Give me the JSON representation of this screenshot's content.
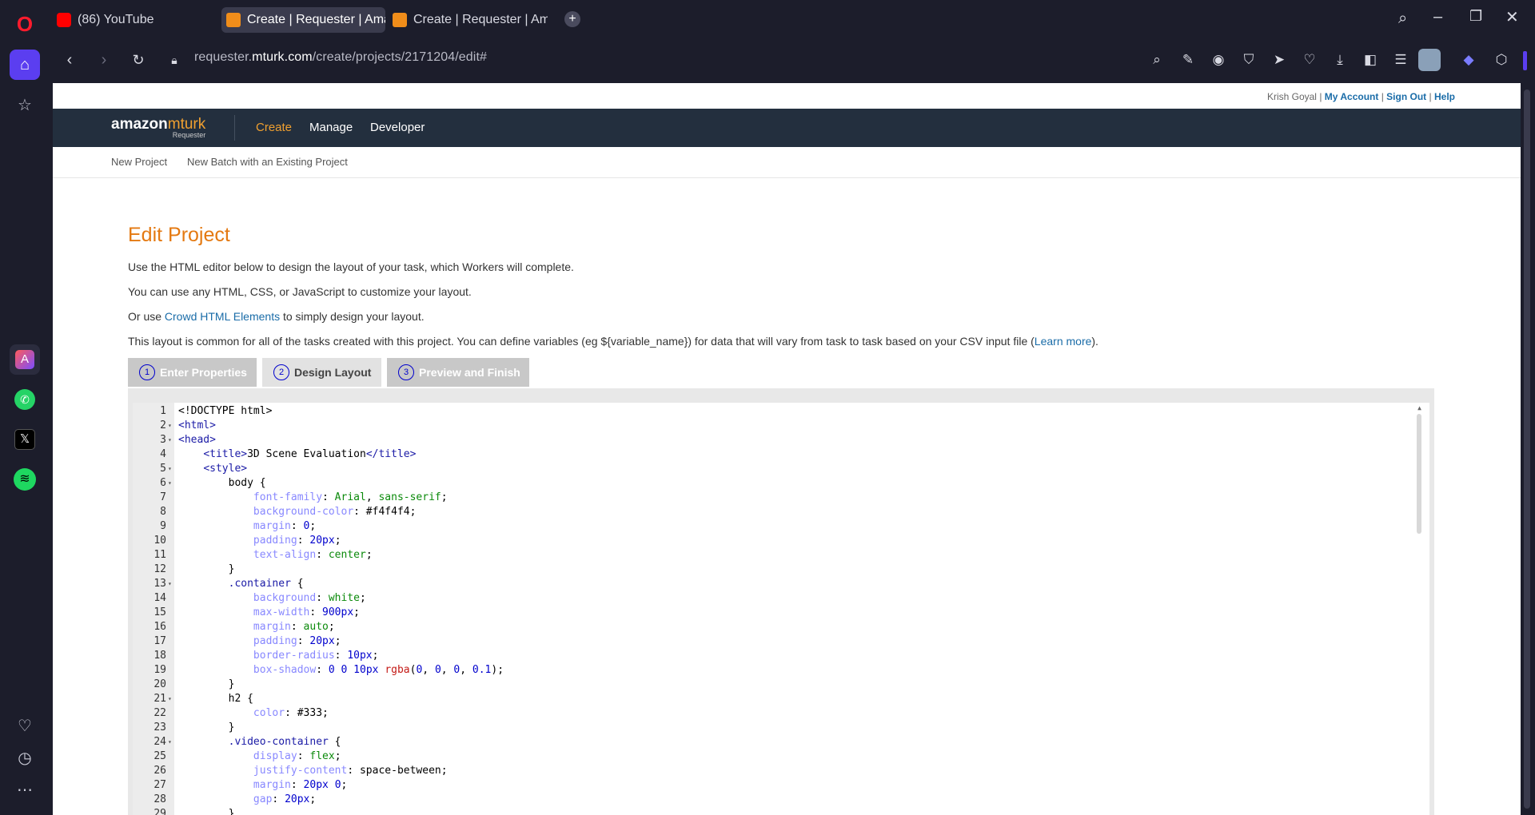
{
  "browser": {
    "tabs": [
      {
        "title": "(86) YouTube",
        "active": false,
        "favicon": "youtube-icon"
      },
      {
        "title": "Create | Requester | Amazon",
        "active": true,
        "favicon": "mturk-icon"
      },
      {
        "title": "Create | Requester | Amazon",
        "active": false,
        "favicon": "mturk-icon"
      }
    ],
    "url_prefix": "requester.",
    "url_domain": "mturk.com",
    "url_path": "/create/projects/2171204/edit#"
  },
  "header": {
    "user": "Krish Goyal",
    "sep": "|",
    "my_account": "My Account",
    "sign_out": "Sign Out",
    "help": "Help",
    "logo_main": "amazon",
    "logo_sub": "mturk",
    "logo_caption": "Requester",
    "nav": [
      "Create",
      "Manage",
      "Developer"
    ],
    "subnav": [
      "New Project",
      "New Batch with an Existing Project"
    ]
  },
  "main": {
    "title": "Edit Project",
    "p1": "Use the HTML editor below to design the layout of your task, which Workers will complete.",
    "p2": "You can use any HTML, CSS, or JavaScript to customize your layout.",
    "p3_pre": "Or use ",
    "p3_link": "Crowd HTML Elements",
    "p3_post": " to simply design your layout.",
    "p4_pre": "This layout is common for all of the tasks created with this project. You can define variables (eg ${variable_name}) for data that will vary from task to task based on your CSV input file (",
    "p4_link": "Learn more",
    "p4_post": ").",
    "steps": [
      {
        "num": "1",
        "label": "Enter Properties"
      },
      {
        "num": "2",
        "label": "Design Layout"
      },
      {
        "num": "3",
        "label": "Preview and Finish"
      }
    ]
  },
  "code": [
    {
      "n": "1",
      "f": false,
      "t": [
        [
          "plain",
          "<!DOCTYPE html>"
        ]
      ]
    },
    {
      "n": "2",
      "f": true,
      "t": [
        [
          "tag",
          "<html>"
        ]
      ]
    },
    {
      "n": "3",
      "f": true,
      "t": [
        [
          "tag",
          "<head>"
        ]
      ]
    },
    {
      "n": "4",
      "f": false,
      "t": [
        [
          "plain",
          "    "
        ],
        [
          "tag",
          "<title>"
        ],
        [
          "plain",
          "3D Scene Evaluation"
        ],
        [
          "tag",
          "</title>"
        ]
      ]
    },
    {
      "n": "5",
      "f": true,
      "t": [
        [
          "plain",
          "    "
        ],
        [
          "tag",
          "<style>"
        ]
      ]
    },
    {
      "n": "6",
      "f": true,
      "t": [
        [
          "plain",
          "        body {"
        ]
      ]
    },
    {
      "n": "7",
      "f": false,
      "t": [
        [
          "plain",
          "            "
        ],
        [
          "prop",
          "font-family"
        ],
        [
          "plain",
          ": "
        ],
        [
          "str",
          "Arial"
        ],
        [
          "plain",
          ", "
        ],
        [
          "str",
          "sans-serif"
        ],
        [
          "plain",
          ";"
        ]
      ]
    },
    {
      "n": "8",
      "f": false,
      "t": [
        [
          "plain",
          "            "
        ],
        [
          "prop",
          "background-color"
        ],
        [
          "plain",
          ": #f4f4f4;"
        ]
      ]
    },
    {
      "n": "9",
      "f": false,
      "t": [
        [
          "plain",
          "            "
        ],
        [
          "prop",
          "margin"
        ],
        [
          "plain",
          ": "
        ],
        [
          "num",
          "0"
        ],
        [
          "plain",
          ";"
        ]
      ]
    },
    {
      "n": "10",
      "f": false,
      "t": [
        [
          "plain",
          "            "
        ],
        [
          "prop",
          "padding"
        ],
        [
          "plain",
          ": "
        ],
        [
          "num",
          "20px"
        ],
        [
          "plain",
          ";"
        ]
      ]
    },
    {
      "n": "11",
      "f": false,
      "t": [
        [
          "plain",
          "            "
        ],
        [
          "prop",
          "text-align"
        ],
        [
          "plain",
          ": "
        ],
        [
          "str",
          "center"
        ],
        [
          "plain",
          ";"
        ]
      ]
    },
    {
      "n": "12",
      "f": false,
      "t": [
        [
          "plain",
          "        }"
        ]
      ]
    },
    {
      "n": "13",
      "f": true,
      "t": [
        [
          "plain",
          "        "
        ],
        [
          "tag",
          ".container"
        ],
        [
          "plain",
          " {"
        ]
      ]
    },
    {
      "n": "14",
      "f": false,
      "t": [
        [
          "plain",
          "            "
        ],
        [
          "prop",
          "background"
        ],
        [
          "plain",
          ": "
        ],
        [
          "str",
          "white"
        ],
        [
          "plain",
          ";"
        ]
      ]
    },
    {
      "n": "15",
      "f": false,
      "t": [
        [
          "plain",
          "            "
        ],
        [
          "prop",
          "max-width"
        ],
        [
          "plain",
          ": "
        ],
        [
          "num",
          "900px"
        ],
        [
          "plain",
          ";"
        ]
      ]
    },
    {
      "n": "16",
      "f": false,
      "t": [
        [
          "plain",
          "            "
        ],
        [
          "prop",
          "margin"
        ],
        [
          "plain",
          ": "
        ],
        [
          "str",
          "auto"
        ],
        [
          "plain",
          ";"
        ]
      ]
    },
    {
      "n": "17",
      "f": false,
      "t": [
        [
          "plain",
          "            "
        ],
        [
          "prop",
          "padding"
        ],
        [
          "plain",
          ": "
        ],
        [
          "num",
          "20px"
        ],
        [
          "plain",
          ";"
        ]
      ]
    },
    {
      "n": "18",
      "f": false,
      "t": [
        [
          "plain",
          "            "
        ],
        [
          "prop",
          "border-radius"
        ],
        [
          "plain",
          ": "
        ],
        [
          "num",
          "10px"
        ],
        [
          "plain",
          ";"
        ]
      ]
    },
    {
      "n": "19",
      "f": false,
      "t": [
        [
          "plain",
          "            "
        ],
        [
          "prop",
          "box-shadow"
        ],
        [
          "plain",
          ": "
        ],
        [
          "num",
          "0 0 10px"
        ],
        [
          "plain",
          " "
        ],
        [
          "fn",
          "rgba"
        ],
        [
          "plain",
          "("
        ],
        [
          "num",
          "0"
        ],
        [
          "plain",
          ", "
        ],
        [
          "num",
          "0"
        ],
        [
          "plain",
          ", "
        ],
        [
          "num",
          "0"
        ],
        [
          "plain",
          ", "
        ],
        [
          "num",
          "0.1"
        ],
        [
          "plain",
          ");"
        ]
      ]
    },
    {
      "n": "20",
      "f": false,
      "t": [
        [
          "plain",
          "        }"
        ]
      ]
    },
    {
      "n": "21",
      "f": true,
      "t": [
        [
          "plain",
          "        h2 {"
        ]
      ]
    },
    {
      "n": "22",
      "f": false,
      "t": [
        [
          "plain",
          "            "
        ],
        [
          "prop",
          "color"
        ],
        [
          "plain",
          ": #333;"
        ]
      ]
    },
    {
      "n": "23",
      "f": false,
      "t": [
        [
          "plain",
          "        }"
        ]
      ]
    },
    {
      "n": "24",
      "f": true,
      "t": [
        [
          "plain",
          "        "
        ],
        [
          "tag",
          ".video-container"
        ],
        [
          "plain",
          " {"
        ]
      ]
    },
    {
      "n": "25",
      "f": false,
      "t": [
        [
          "plain",
          "            "
        ],
        [
          "prop",
          "display"
        ],
        [
          "plain",
          ": "
        ],
        [
          "str",
          "flex"
        ],
        [
          "plain",
          ";"
        ]
      ]
    },
    {
      "n": "26",
      "f": false,
      "t": [
        [
          "plain",
          "            "
        ],
        [
          "prop",
          "justify-content"
        ],
        [
          "plain",
          ": space-between;"
        ]
      ]
    },
    {
      "n": "27",
      "f": false,
      "t": [
        [
          "plain",
          "            "
        ],
        [
          "prop",
          "margin"
        ],
        [
          "plain",
          ": "
        ],
        [
          "num",
          "20px"
        ],
        [
          "plain",
          " "
        ],
        [
          "num",
          "0"
        ],
        [
          "plain",
          ";"
        ]
      ]
    },
    {
      "n": "28",
      "f": false,
      "t": [
        [
          "plain",
          "            "
        ],
        [
          "prop",
          "gap"
        ],
        [
          "plain",
          ": "
        ],
        [
          "num",
          "20px"
        ],
        [
          "plain",
          ";"
        ]
      ]
    },
    {
      "n": "29",
      "f": false,
      "t": [
        [
          "plain",
          "        }"
        ]
      ]
    }
  ]
}
